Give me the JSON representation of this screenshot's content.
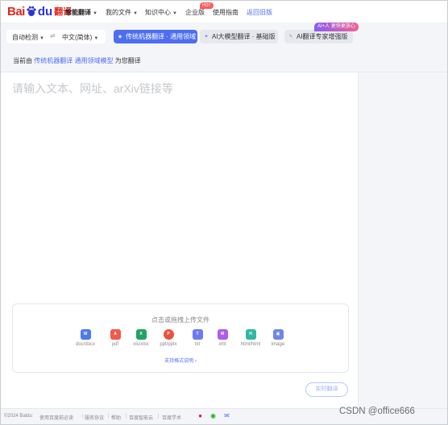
{
  "logo": {
    "bai": "Bai",
    "du": "du",
    "fanyi": "翻译"
  },
  "nav": {
    "items": [
      {
        "label": "智能翻译",
        "caret": true
      },
      {
        "label": "我的文件",
        "caret": true
      },
      {
        "label": "知识中心",
        "caret": true
      },
      {
        "label": "企业版",
        "caret": false
      },
      {
        "label": "使用指南",
        "caret": false
      },
      {
        "label": "返回旧版",
        "caret": false
      }
    ],
    "hot_badge": "HOT"
  },
  "lang": {
    "source": "自动检测",
    "target": "中文(简体)",
    "swap": "⇌"
  },
  "modes": {
    "traditional": "传统机器翻译 · 通用领域",
    "llm": "AI大模型翻译 · 基础版",
    "pro": "AI翻译专家增强版",
    "pro_badge": "AI+人 更快更放心"
  },
  "notice": {
    "prefix": "当前由",
    "engine": "传统机器翻译",
    "model": "通用领域模型",
    "suffix": "为您翻译"
  },
  "input": {
    "placeholder": "请输入文本、网址、arXiv链接等"
  },
  "upload": {
    "title": "点击或拖拽上传文件",
    "types": [
      {
        "label": "doc/docx",
        "icon": "word-icon",
        "color": "#4b7bec"
      },
      {
        "label": "pdf",
        "icon": "pdf-icon",
        "color": "#f05a4a"
      },
      {
        "label": "xls/xlsx",
        "icon": "excel-icon",
        "color": "#21a366"
      },
      {
        "label": "ppt/pptx",
        "icon": "ppt-icon",
        "color": "#e8533f"
      },
      {
        "label": "txt",
        "icon": "txt-icon",
        "color": "#6c7cf0"
      },
      {
        "label": "xml",
        "icon": "xml-icon",
        "color": "#b15de8"
      },
      {
        "label": "html/html",
        "icon": "html-icon",
        "color": "#2fb7a4"
      },
      {
        "label": "image",
        "icon": "image-icon",
        "color": "#6f86e8"
      }
    ],
    "format_link": "支持格式说明 ›"
  },
  "translate_button": "实时翻译",
  "footer": {
    "copyright": "©2024 Baidu",
    "links": [
      "使用百度前必读",
      "服务协议",
      "帮助",
      "百度智能云",
      "百度学术"
    ]
  },
  "watermark": "CSDN @office666"
}
